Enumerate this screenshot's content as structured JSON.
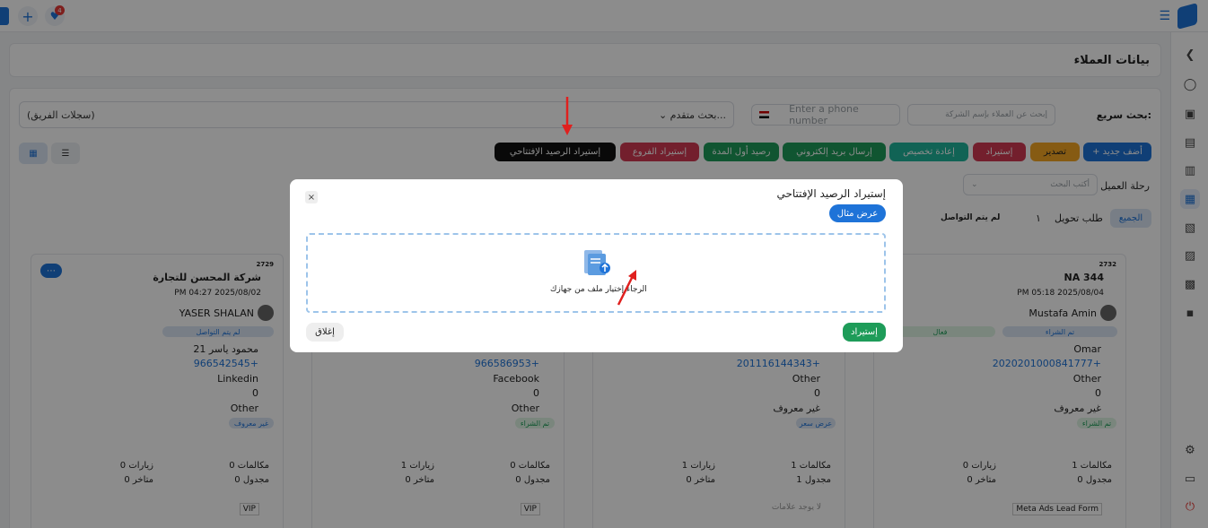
{
  "page_title": "بيانات العملاء",
  "search": {
    "quick_label": "بحث سريع:",
    "company_placeholder": "إبحث عن العملاء بإسم الشركة",
    "phone_placeholder": "Enter a phone number",
    "advanced": "بحث متقدم...",
    "team_records": "(سجلات الفريق)"
  },
  "toolbar": {
    "add": "أضف جديد",
    "export": "تصدير",
    "import": "إستيراد",
    "reassign": "إعادة تخصيص",
    "email": "إرسال بريد إلكتروني",
    "period_balance": "رصيد أول المدة",
    "import_branches": "إستيراد الفروع",
    "import_opening": "إستيراد الرصيد الإفتتاحي"
  },
  "journey": {
    "label": "رحلة العميل",
    "placeholder": "أكتب البحث"
  },
  "stages": {
    "all": "الجميع",
    "transfer": "طلب تحويل",
    "count": "١",
    "no_contact": "لم يتم التواصل"
  },
  "cards": [
    {
      "id": "2729",
      "name": "شركة المحسن للتجارة",
      "date": "PM 04:27 2025/08/02",
      "owner": "YASER SHALAN",
      "status": "لم يتم التواصل",
      "contact": "محمود ياسر 21",
      "phone": "966542545+",
      "source": "Linkedin",
      "rating": "0",
      "other": "Other",
      "tag": "غير معروف",
      "calls_label": "مكالمات",
      "calls": "0",
      "visits_label": "زيارات",
      "visits": "0",
      "scheduled_label": "مجدول",
      "scheduled": "0",
      "late_label": "متاخر",
      "late": "0",
      "footer": "VIP"
    },
    {
      "phone": "966586953+",
      "source": "Facebook",
      "rating": "0",
      "other": "Other",
      "tag": "تم الشراء",
      "calls_label": "مكالمات",
      "calls": "0",
      "visits_label": "زيارات",
      "visits": "1",
      "scheduled_label": "مجدول",
      "scheduled": "0",
      "late_label": "متاخر",
      "late": "0",
      "footer": "VIP"
    },
    {
      "phone": "201116144343+",
      "source": "Other",
      "rating": "0",
      "other": "غير معروف",
      "tag": "عرض سعر",
      "calls_label": "مكالمات",
      "calls": "1",
      "visits_label": "زيارات",
      "visits": "1",
      "scheduled_label": "مجدول",
      "scheduled": "1",
      "late_label": "متاخر",
      "late": "0",
      "footer": "لا يوجد علامات"
    },
    {
      "id": "2732",
      "name": "NA 344",
      "date": "PM 05:18 2025/08/04",
      "owner": "Mustafa Amin",
      "status": "تم الشراء",
      "status2": "فعال",
      "contact": "Omar",
      "phone": "2020201000841777+",
      "source": "Other",
      "rating": "0",
      "other": "غير معروف",
      "tag": "تم الشراء",
      "calls_label": "مكالمات",
      "calls": "1",
      "visits_label": "زيارات",
      "visits": "0",
      "scheduled_label": "مجدول",
      "scheduled": "0",
      "late_label": "متاخر",
      "late": "0",
      "footer": "Meta Ads Lead Form"
    }
  ],
  "modal": {
    "title": "إستيراد الرصيد الإفتتاحي",
    "example": "عرض مثال",
    "drop_text": "الرجاء إختيار ملف من جهازك",
    "import": "إستيراد",
    "close": "إغلاق"
  },
  "colors": {
    "blue": "#1e73d8",
    "orange": "#f5a623",
    "red": "#d23a52",
    "teal": "#1fb59c",
    "green": "#1e9c59",
    "black": "#111111"
  }
}
